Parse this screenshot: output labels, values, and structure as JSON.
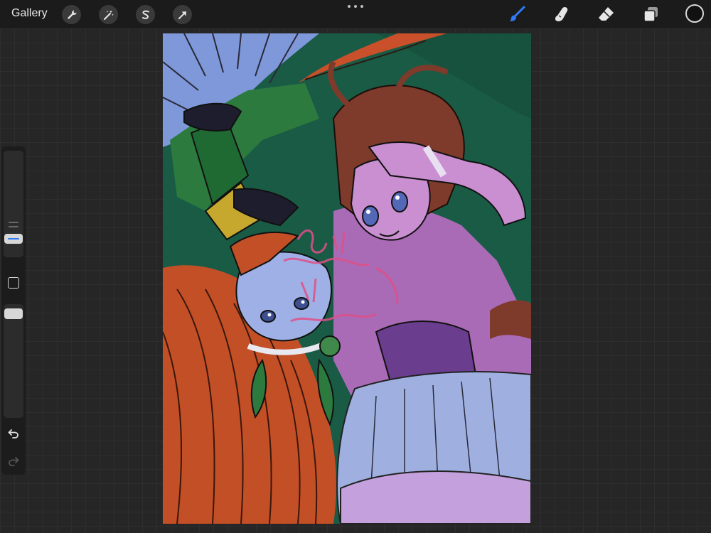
{
  "topbar": {
    "gallery_label": "Gallery",
    "left_tools": [
      {
        "name": "actions",
        "icon": "wrench-icon"
      },
      {
        "name": "adjustments",
        "icon": "magic-wand-icon"
      },
      {
        "name": "selection",
        "icon": "selection-s-icon"
      },
      {
        "name": "transform",
        "icon": "arrow-cursor-icon"
      }
    ],
    "center": {
      "icon": "more-dots-icon"
    },
    "right_tools": [
      {
        "name": "brush",
        "icon": "brush-icon",
        "active": true,
        "color": "#2f7bf5"
      },
      {
        "name": "smudge",
        "icon": "smudge-finger-icon",
        "active": false
      },
      {
        "name": "eraser",
        "icon": "eraser-icon",
        "active": false
      },
      {
        "name": "layers",
        "icon": "layers-icon",
        "active": false
      },
      {
        "name": "color",
        "icon": "color-swatch-icon",
        "color": "#111111"
      }
    ]
  },
  "sidebar": {
    "brush_size": {
      "icon": "size-slider-icon",
      "value": 0.16
    },
    "modify_button": {
      "icon": "square-icon"
    },
    "opacity": {
      "icon": "opacity-slider-icon",
      "value": 1.0
    },
    "undo": {
      "icon": "undo-icon"
    },
    "redo": {
      "icon": "redo-icon",
      "enabled": false
    }
  },
  "canvas": {
    "artwork": "anime-illustration",
    "watermark_color": "#e0508a",
    "background_color": "#1a5b45",
    "accent_colors": [
      "#7b95d6",
      "#c9502a",
      "#7e3a2a",
      "#6b3d8f",
      "#2c7a3e",
      "#d6b8e6"
    ]
  }
}
